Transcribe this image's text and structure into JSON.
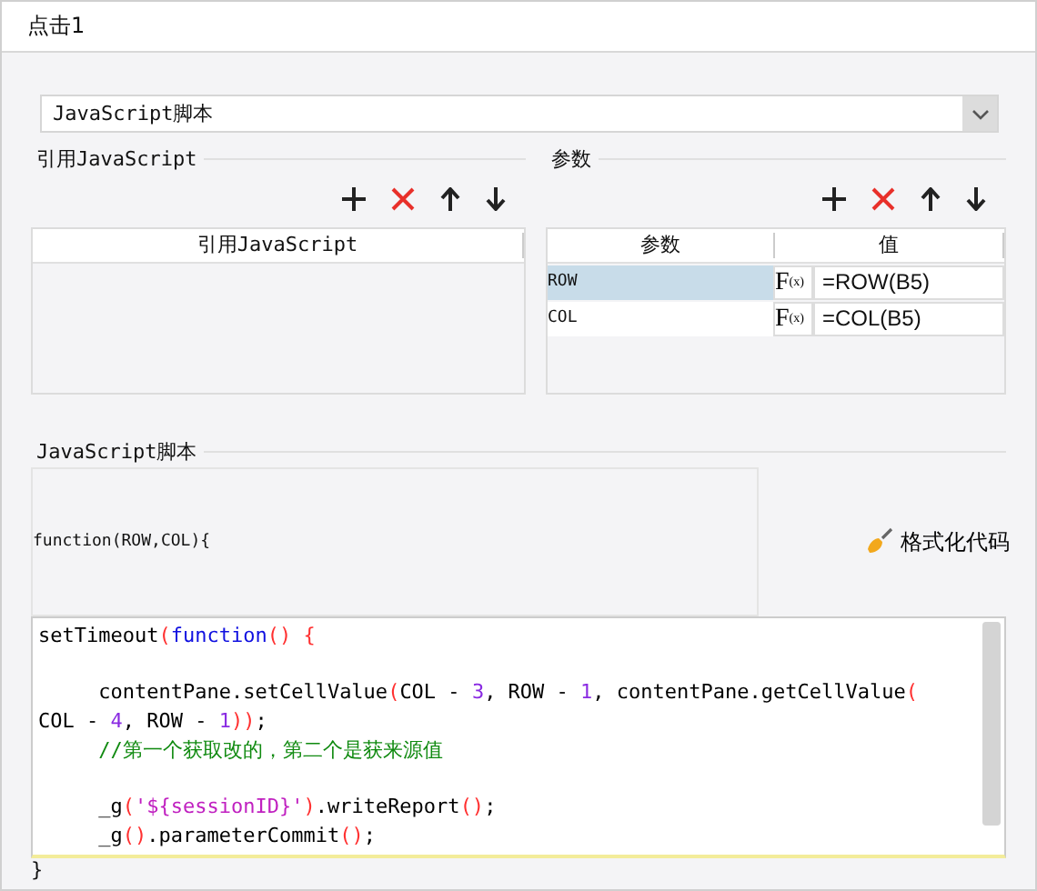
{
  "window": {
    "title": "点击1"
  },
  "script_type": {
    "value": "JavaScript脚本"
  },
  "referenced_js": {
    "legend": "引用JavaScript",
    "columns": [
      "引用JavaScript"
    ]
  },
  "parameters": {
    "legend": "参数",
    "columns": [
      "参数",
      "值"
    ],
    "rows": [
      {
        "name": "ROW",
        "formula_icon": "F",
        "formula_sub": "(x)",
        "value": "=ROW(B5)",
        "selected": true
      },
      {
        "name": "COL",
        "formula_icon": "F",
        "formula_sub": "(x)",
        "value": "=COL(B5)",
        "selected": false
      }
    ]
  },
  "script": {
    "legend": "JavaScript脚本",
    "header": "function(ROW,COL){",
    "format_button": "格式化代码",
    "blocks": [
      {
        "lines": [
          {
            "tokens": [
              {
                "kind": "plain",
                "text": "setTimeout"
              },
              {
                "kind": "paren",
                "text": "("
              },
              {
                "kind": "keyword",
                "text": "function"
              },
              {
                "kind": "paren",
                "text": "() {"
              }
            ]
          }
        ]
      },
      {
        "lines": [
          {
            "tokens": [
              {
                "kind": "plain",
                "text": "     contentPane.setCellValue"
              },
              {
                "kind": "paren",
                "text": "("
              },
              {
                "kind": "plain",
                "text": "COL - "
              },
              {
                "kind": "number",
                "text": "3"
              },
              {
                "kind": "plain",
                "text": ", ROW - "
              },
              {
                "kind": "number",
                "text": "1"
              },
              {
                "kind": "plain",
                "text": ", contentPane.getCellValue"
              },
              {
                "kind": "paren",
                "text": "("
              }
            ]
          },
          {
            "tokens": [
              {
                "kind": "plain",
                "text": "COL - "
              },
              {
                "kind": "number",
                "text": "4"
              },
              {
                "kind": "plain",
                "text": ", ROW - "
              },
              {
                "kind": "number",
                "text": "1"
              },
              {
                "kind": "paren",
                "text": "))"
              },
              {
                "kind": "plain",
                "text": ";"
              }
            ]
          },
          {
            "tokens": [
              {
                "kind": "comment",
                "text": "     //第一个获取改的，第二个是获来源值"
              }
            ]
          }
        ]
      },
      {
        "lines": [
          {
            "tokens": [
              {
                "kind": "plain",
                "text": "     _g"
              },
              {
                "kind": "paren",
                "text": "("
              },
              {
                "kind": "string",
                "text": "'${sessionID}'"
              },
              {
                "kind": "paren",
                "text": ")"
              },
              {
                "kind": "plain",
                "text": ".writeReport"
              },
              {
                "kind": "paren",
                "text": "()"
              },
              {
                "kind": "plain",
                "text": ";"
              }
            ]
          },
          {
            "tokens": [
              {
                "kind": "plain",
                "text": "     _g"
              },
              {
                "kind": "paren",
                "text": "()"
              },
              {
                "kind": "plain",
                "text": ".parameterCommit"
              },
              {
                "kind": "paren",
                "text": "()"
              },
              {
                "kind": "plain",
                "text": ";"
              }
            ]
          }
        ]
      }
    ],
    "footer": "}"
  }
}
